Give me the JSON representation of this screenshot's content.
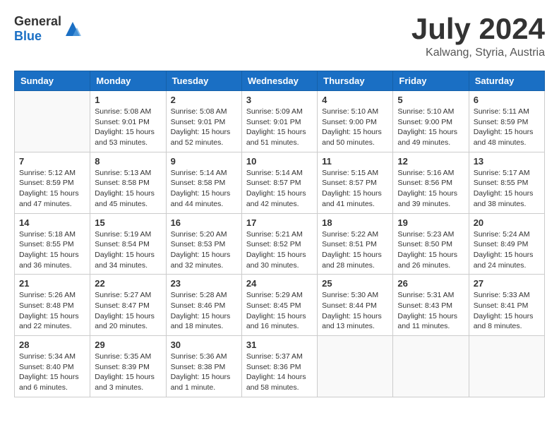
{
  "header": {
    "logo_general": "General",
    "logo_blue": "Blue",
    "month_year": "July 2024",
    "location": "Kalwang, Styria, Austria"
  },
  "weekdays": [
    "Sunday",
    "Monday",
    "Tuesday",
    "Wednesday",
    "Thursday",
    "Friday",
    "Saturday"
  ],
  "weeks": [
    [
      {
        "day": "",
        "info": ""
      },
      {
        "day": "1",
        "info": "Sunrise: 5:08 AM\nSunset: 9:01 PM\nDaylight: 15 hours\nand 53 minutes."
      },
      {
        "day": "2",
        "info": "Sunrise: 5:08 AM\nSunset: 9:01 PM\nDaylight: 15 hours\nand 52 minutes."
      },
      {
        "day": "3",
        "info": "Sunrise: 5:09 AM\nSunset: 9:01 PM\nDaylight: 15 hours\nand 51 minutes."
      },
      {
        "day": "4",
        "info": "Sunrise: 5:10 AM\nSunset: 9:00 PM\nDaylight: 15 hours\nand 50 minutes."
      },
      {
        "day": "5",
        "info": "Sunrise: 5:10 AM\nSunset: 9:00 PM\nDaylight: 15 hours\nand 49 minutes."
      },
      {
        "day": "6",
        "info": "Sunrise: 5:11 AM\nSunset: 8:59 PM\nDaylight: 15 hours\nand 48 minutes."
      }
    ],
    [
      {
        "day": "7",
        "info": "Sunrise: 5:12 AM\nSunset: 8:59 PM\nDaylight: 15 hours\nand 47 minutes."
      },
      {
        "day": "8",
        "info": "Sunrise: 5:13 AM\nSunset: 8:58 PM\nDaylight: 15 hours\nand 45 minutes."
      },
      {
        "day": "9",
        "info": "Sunrise: 5:14 AM\nSunset: 8:58 PM\nDaylight: 15 hours\nand 44 minutes."
      },
      {
        "day": "10",
        "info": "Sunrise: 5:14 AM\nSunset: 8:57 PM\nDaylight: 15 hours\nand 42 minutes."
      },
      {
        "day": "11",
        "info": "Sunrise: 5:15 AM\nSunset: 8:57 PM\nDaylight: 15 hours\nand 41 minutes."
      },
      {
        "day": "12",
        "info": "Sunrise: 5:16 AM\nSunset: 8:56 PM\nDaylight: 15 hours\nand 39 minutes."
      },
      {
        "day": "13",
        "info": "Sunrise: 5:17 AM\nSunset: 8:55 PM\nDaylight: 15 hours\nand 38 minutes."
      }
    ],
    [
      {
        "day": "14",
        "info": "Sunrise: 5:18 AM\nSunset: 8:55 PM\nDaylight: 15 hours\nand 36 minutes."
      },
      {
        "day": "15",
        "info": "Sunrise: 5:19 AM\nSunset: 8:54 PM\nDaylight: 15 hours\nand 34 minutes."
      },
      {
        "day": "16",
        "info": "Sunrise: 5:20 AM\nSunset: 8:53 PM\nDaylight: 15 hours\nand 32 minutes."
      },
      {
        "day": "17",
        "info": "Sunrise: 5:21 AM\nSunset: 8:52 PM\nDaylight: 15 hours\nand 30 minutes."
      },
      {
        "day": "18",
        "info": "Sunrise: 5:22 AM\nSunset: 8:51 PM\nDaylight: 15 hours\nand 28 minutes."
      },
      {
        "day": "19",
        "info": "Sunrise: 5:23 AM\nSunset: 8:50 PM\nDaylight: 15 hours\nand 26 minutes."
      },
      {
        "day": "20",
        "info": "Sunrise: 5:24 AM\nSunset: 8:49 PM\nDaylight: 15 hours\nand 24 minutes."
      }
    ],
    [
      {
        "day": "21",
        "info": "Sunrise: 5:26 AM\nSunset: 8:48 PM\nDaylight: 15 hours\nand 22 minutes."
      },
      {
        "day": "22",
        "info": "Sunrise: 5:27 AM\nSunset: 8:47 PM\nDaylight: 15 hours\nand 20 minutes."
      },
      {
        "day": "23",
        "info": "Sunrise: 5:28 AM\nSunset: 8:46 PM\nDaylight: 15 hours\nand 18 minutes."
      },
      {
        "day": "24",
        "info": "Sunrise: 5:29 AM\nSunset: 8:45 PM\nDaylight: 15 hours\nand 16 minutes."
      },
      {
        "day": "25",
        "info": "Sunrise: 5:30 AM\nSunset: 8:44 PM\nDaylight: 15 hours\nand 13 minutes."
      },
      {
        "day": "26",
        "info": "Sunrise: 5:31 AM\nSunset: 8:43 PM\nDaylight: 15 hours\nand 11 minutes."
      },
      {
        "day": "27",
        "info": "Sunrise: 5:33 AM\nSunset: 8:41 PM\nDaylight: 15 hours\nand 8 minutes."
      }
    ],
    [
      {
        "day": "28",
        "info": "Sunrise: 5:34 AM\nSunset: 8:40 PM\nDaylight: 15 hours\nand 6 minutes."
      },
      {
        "day": "29",
        "info": "Sunrise: 5:35 AM\nSunset: 8:39 PM\nDaylight: 15 hours\nand 3 minutes."
      },
      {
        "day": "30",
        "info": "Sunrise: 5:36 AM\nSunset: 8:38 PM\nDaylight: 15 hours\nand 1 minute."
      },
      {
        "day": "31",
        "info": "Sunrise: 5:37 AM\nSunset: 8:36 PM\nDaylight: 14 hours\nand 58 minutes."
      },
      {
        "day": "",
        "info": ""
      },
      {
        "day": "",
        "info": ""
      },
      {
        "day": "",
        "info": ""
      }
    ]
  ]
}
